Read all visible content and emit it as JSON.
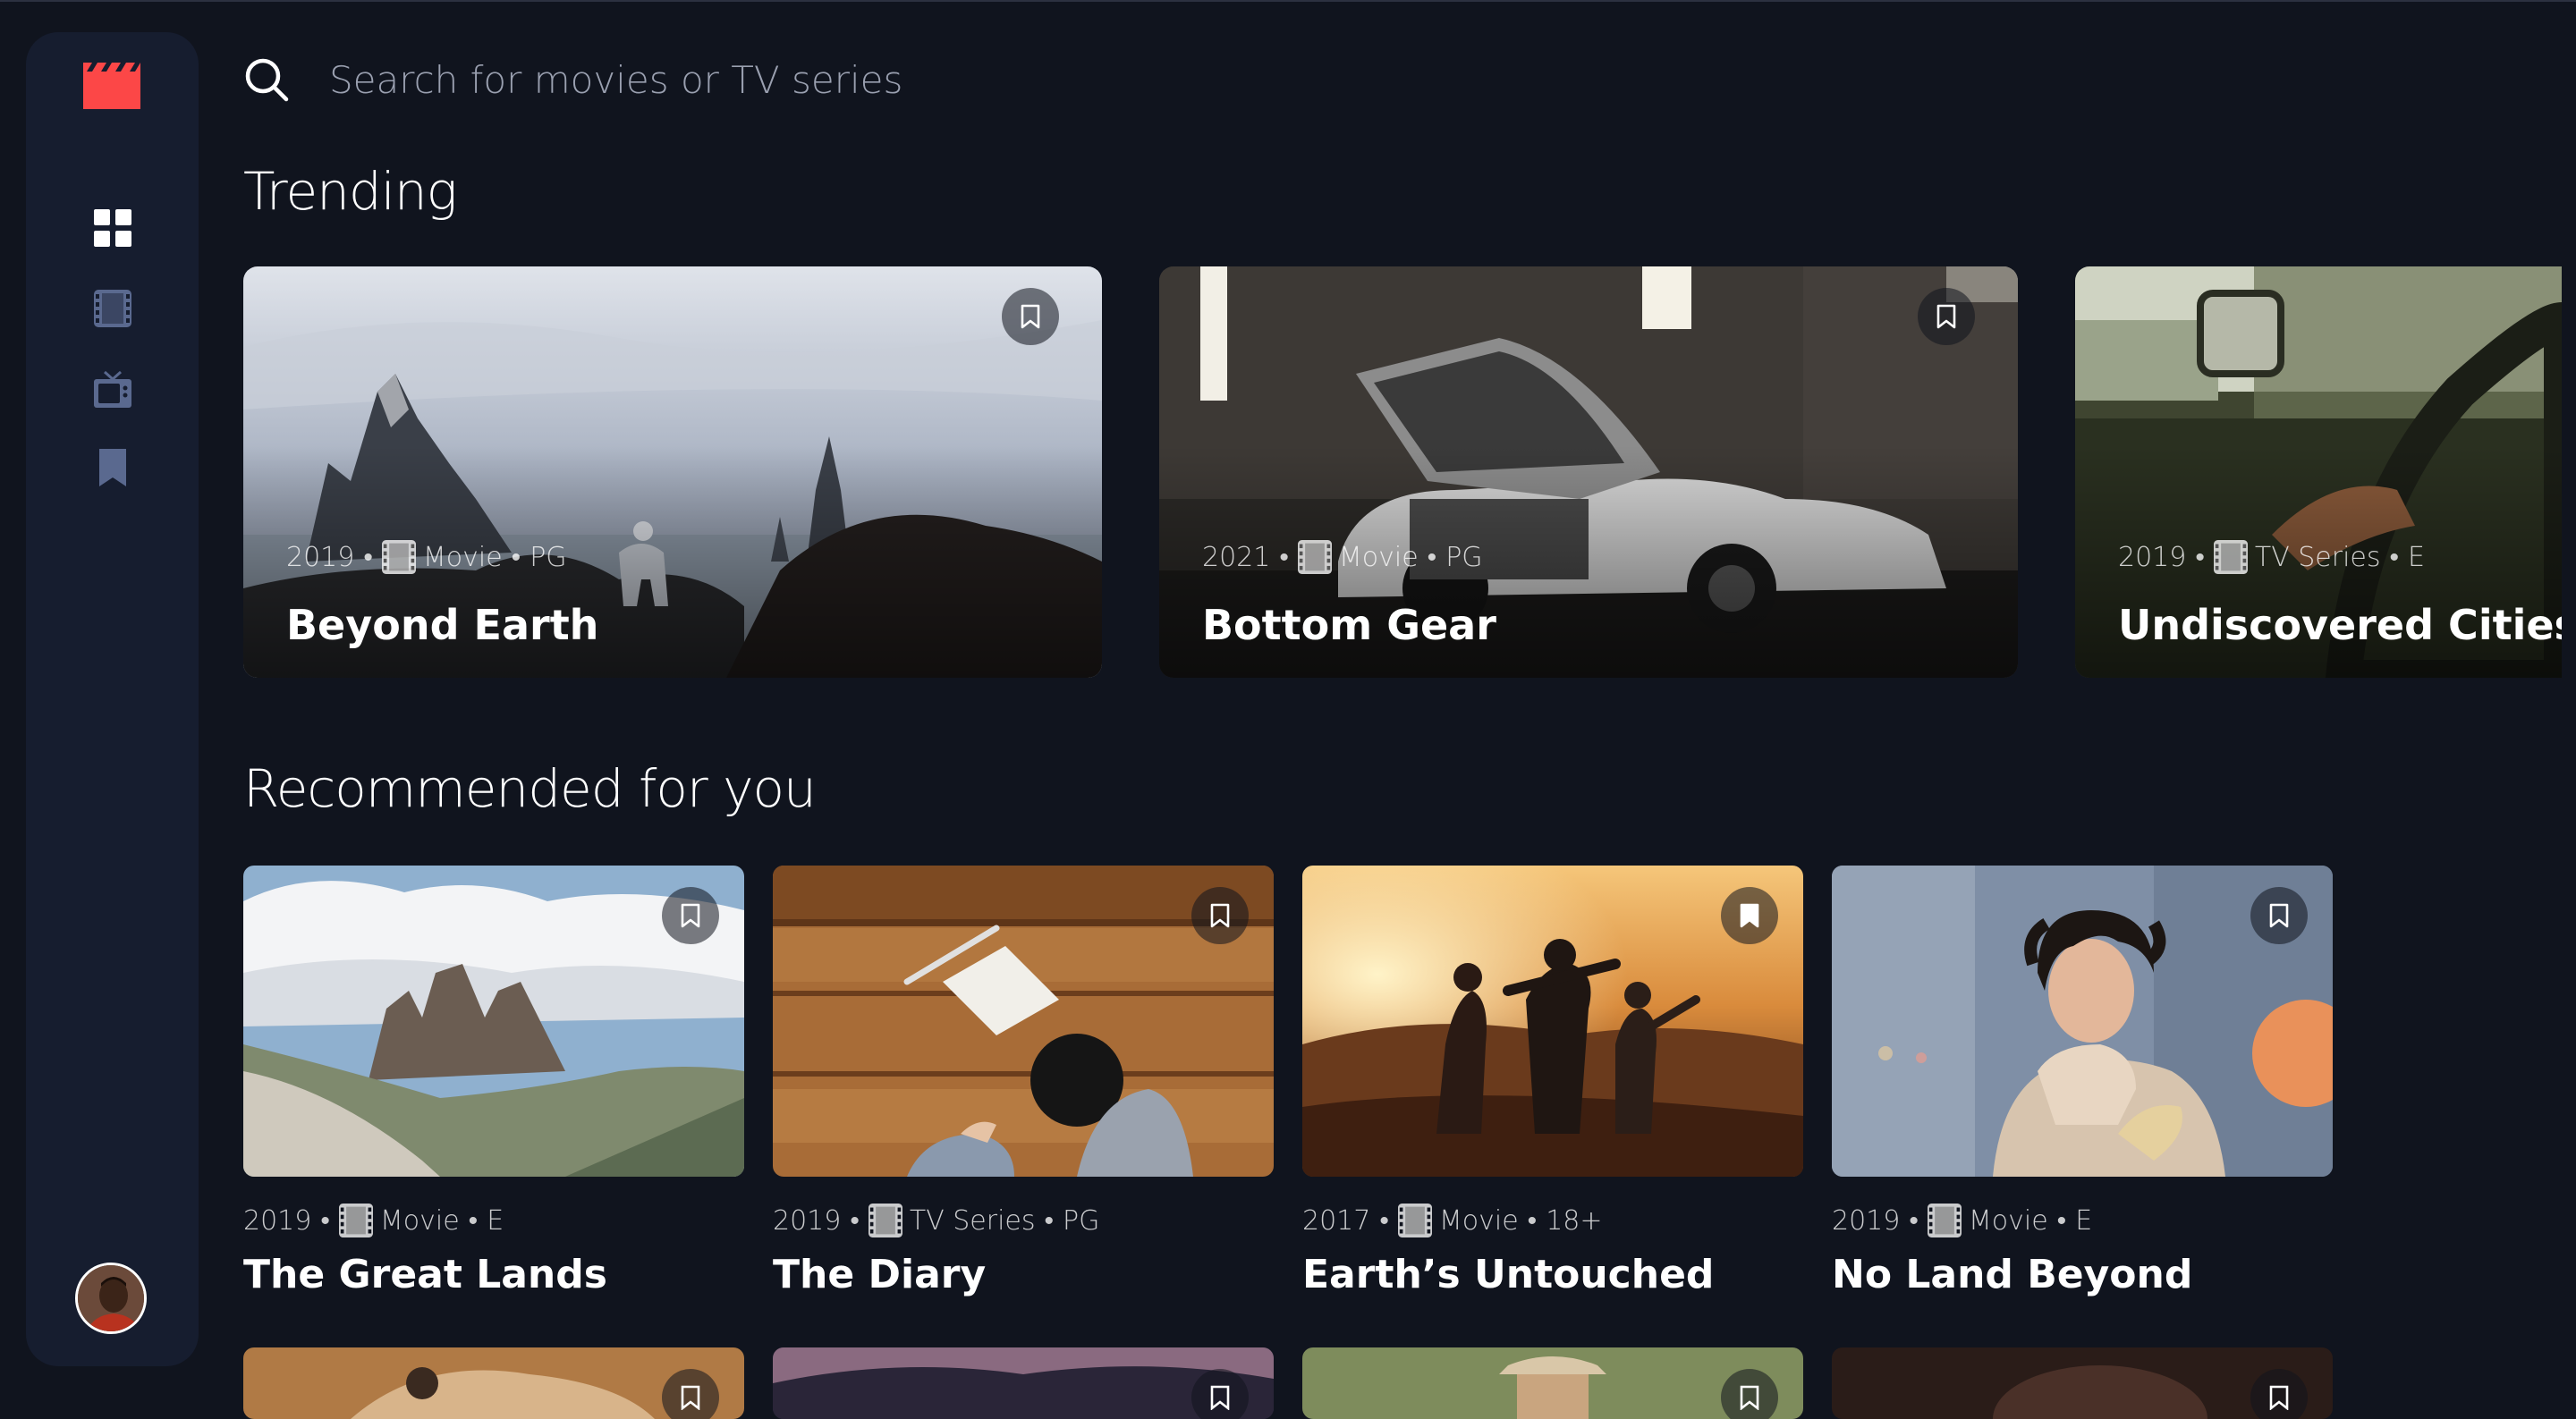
{
  "app": {
    "logo_icon": "clapperboard-icon",
    "accent_color": "#FC4747",
    "background_color": "#10141E",
    "panel_color": "#161D2F"
  },
  "sidebar": {
    "items": [
      {
        "name": "home",
        "icon": "grid-icon",
        "active": true
      },
      {
        "name": "movies",
        "icon": "film-icon",
        "active": false
      },
      {
        "name": "tv-series",
        "icon": "tv-icon",
        "active": false
      },
      {
        "name": "bookmarks",
        "icon": "bookmark-icon",
        "active": false
      }
    ],
    "avatar_icon": "user-avatar"
  },
  "search": {
    "placeholder": "Search for movies or TV series",
    "value": ""
  },
  "trending": {
    "title": "Trending",
    "items": [
      {
        "year": "2019",
        "category": "Movie",
        "rating": "PG",
        "title": "Beyond Earth",
        "bookmarked": false
      },
      {
        "year": "2021",
        "category": "Movie",
        "rating": "PG",
        "title": "Bottom Gear",
        "bookmarked": false
      },
      {
        "year": "2019",
        "category": "TV Series",
        "rating": "E",
        "title": "Undiscovered Cities",
        "bookmarked": false
      }
    ]
  },
  "recommended": {
    "title": "Recommended for you",
    "items": [
      {
        "year": "2019",
        "category": "Movie",
        "rating": "E",
        "title": "The Great Lands",
        "bookmarked": false
      },
      {
        "year": "2019",
        "category": "TV Series",
        "rating": "PG",
        "title": "The Diary",
        "bookmarked": false
      },
      {
        "year": "2017",
        "category": "Movie",
        "rating": "18+",
        "title": "Earth’s Untouched",
        "bookmarked": true
      },
      {
        "year": "2019",
        "category": "Movie",
        "rating": "E",
        "title": "No Land Beyond",
        "bookmarked": false
      }
    ]
  },
  "meta_separator": "•"
}
